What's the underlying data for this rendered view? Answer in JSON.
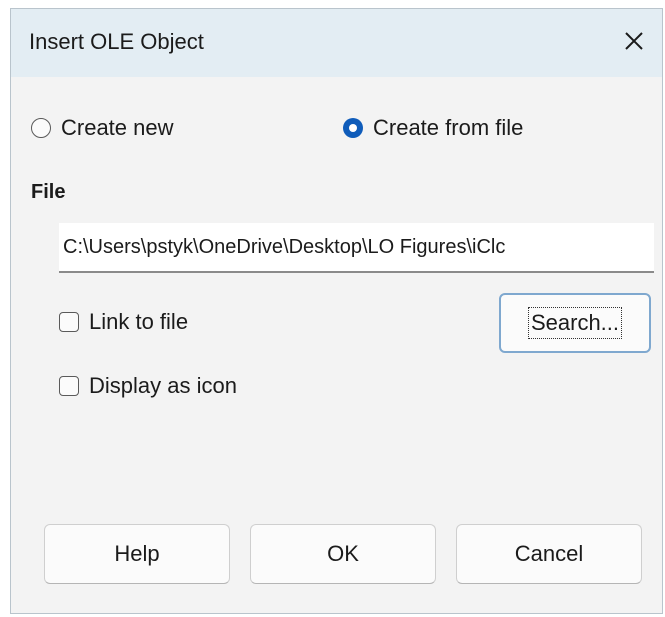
{
  "window": {
    "title": "Insert OLE Object",
    "close_icon": "close-icon"
  },
  "options": {
    "create_new_label": "Create new",
    "create_from_file_label": "Create from file",
    "selected": "create_from_file"
  },
  "file": {
    "section_label": "File",
    "path_value": "C:\\Users\\pstyk\\OneDrive\\Desktop\\LO Figures\\iClc",
    "link_to_file_label": "Link to file",
    "link_to_file_checked": false,
    "display_as_icon_label": "Display as icon",
    "display_as_icon_checked": false,
    "search_label": "Search..."
  },
  "buttons": {
    "help": "Help",
    "ok": "OK",
    "cancel": "Cancel"
  },
  "colors": {
    "accent": "#0f5cba",
    "titlebar": "#e3edf3",
    "dialog_bg": "#f3f3f3"
  }
}
